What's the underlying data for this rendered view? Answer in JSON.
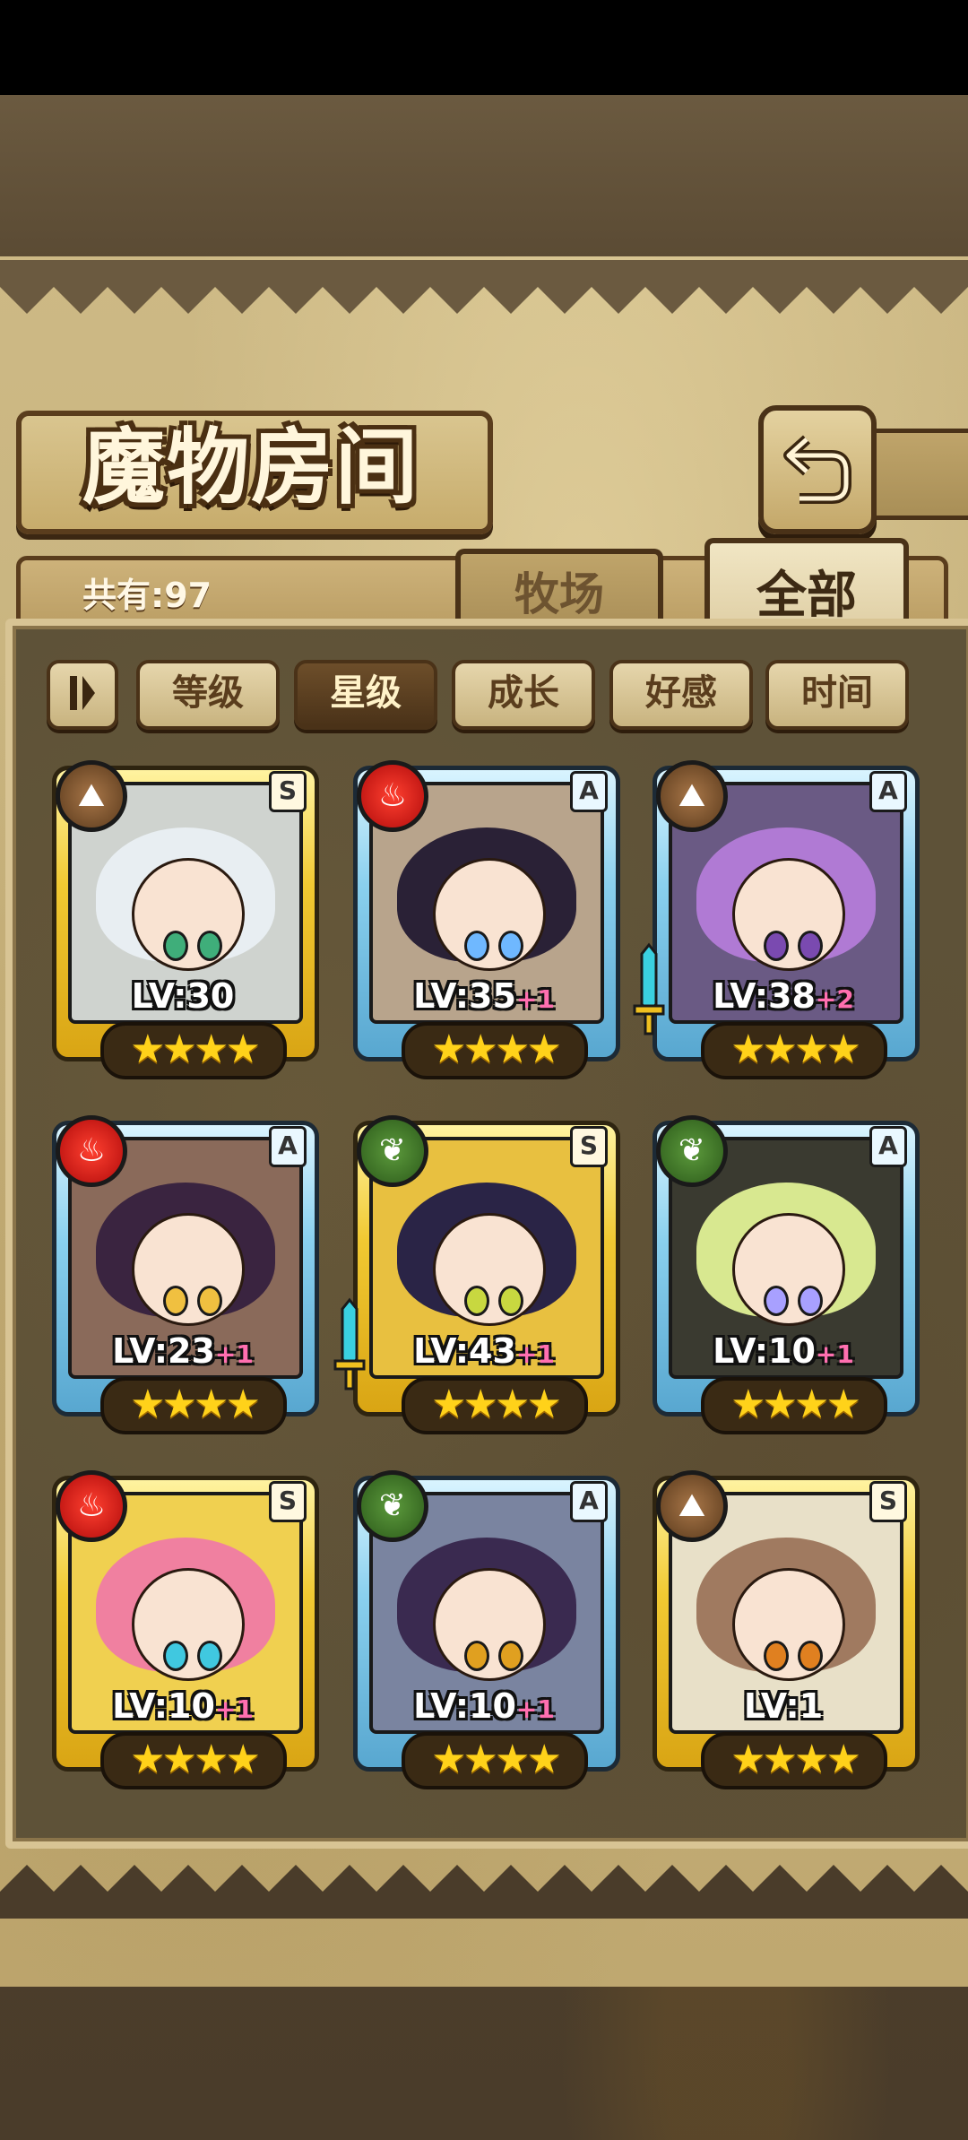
{
  "title": "魔物房间",
  "count_label": "共有:97",
  "tabs": [
    {
      "label": "牧场",
      "active": false
    },
    {
      "label": "全部",
      "active": true
    }
  ],
  "sort": {
    "toggle_icon": "pause-sort-toggle-icon",
    "buttons": [
      {
        "label": "等级",
        "active": false
      },
      {
        "label": "星级",
        "active": true
      },
      {
        "label": "成长",
        "active": false
      },
      {
        "label": "好感",
        "active": false
      },
      {
        "label": "时间",
        "active": false
      }
    ]
  },
  "colors": {
    "gold_frame": "#f1c932",
    "blue_frame": "#8ad0ee",
    "fire": "#d01a12",
    "earth": "#7a5230",
    "grass": "#3a7226",
    "plus_pink": "#ff6fb0",
    "star": "#ffd21a"
  },
  "monsters": [
    {
      "rank": "S",
      "element": "earth",
      "level": "LV:30",
      "plus": "",
      "stars": "★★★★",
      "frame": "gold",
      "weapon": false,
      "hair": "#e8eef2",
      "eyes": "#3fae7a",
      "bg": "#cfd3cf"
    },
    {
      "rank": "A",
      "element": "fire",
      "level": "LV:35",
      "plus": "+1",
      "stars": "★★★★",
      "frame": "blue",
      "weapon": false,
      "hair": "#2a2136",
      "eyes": "#6fb8ff",
      "bg": "#b8a48c"
    },
    {
      "rank": "A",
      "element": "earth",
      "level": "LV:38",
      "plus": "+2",
      "stars": "★★★★",
      "frame": "blue",
      "weapon": true,
      "hair": "#b07ad4",
      "eyes": "#7a4ab0",
      "bg": "#6a5a84"
    },
    {
      "rank": "A",
      "element": "fire",
      "level": "LV:23",
      "plus": "+1",
      "stars": "★★★★",
      "frame": "blue",
      "weapon": false,
      "hair": "#3a2440",
      "eyes": "#f0c040",
      "bg": "#8a6a5a"
    },
    {
      "rank": "S",
      "element": "grass",
      "level": "LV:43",
      "plus": "+1",
      "stars": "★★★★",
      "frame": "gold",
      "weapon": true,
      "hair": "#2a2446",
      "eyes": "#c8d840",
      "bg": "#e8c040"
    },
    {
      "rank": "A",
      "element": "grass",
      "level": "LV:10",
      "plus": "+1",
      "stars": "★★★★",
      "frame": "blue",
      "weapon": false,
      "hair": "#d8e890",
      "eyes": "#a8a0ff",
      "bg": "#3a3a30"
    },
    {
      "rank": "S",
      "element": "fire",
      "level": "LV:10",
      "plus": "+1",
      "stars": "★★★★",
      "frame": "gold",
      "weapon": false,
      "hair": "#f080a0",
      "eyes": "#40c8e0",
      "bg": "#f0d050"
    },
    {
      "rank": "A",
      "element": "grass",
      "level": "LV:10",
      "plus": "+1",
      "stars": "★★★★",
      "frame": "blue",
      "weapon": false,
      "hair": "#3a2a50",
      "eyes": "#e0a020",
      "bg": "#7a84a0"
    },
    {
      "rank": "S",
      "element": "earth",
      "level": "LV:1",
      "plus": "",
      "stars": "★★★★",
      "frame": "gold",
      "weapon": false,
      "hair": "#a07a60",
      "eyes": "#e08020",
      "bg": "#e8e0c8"
    }
  ]
}
